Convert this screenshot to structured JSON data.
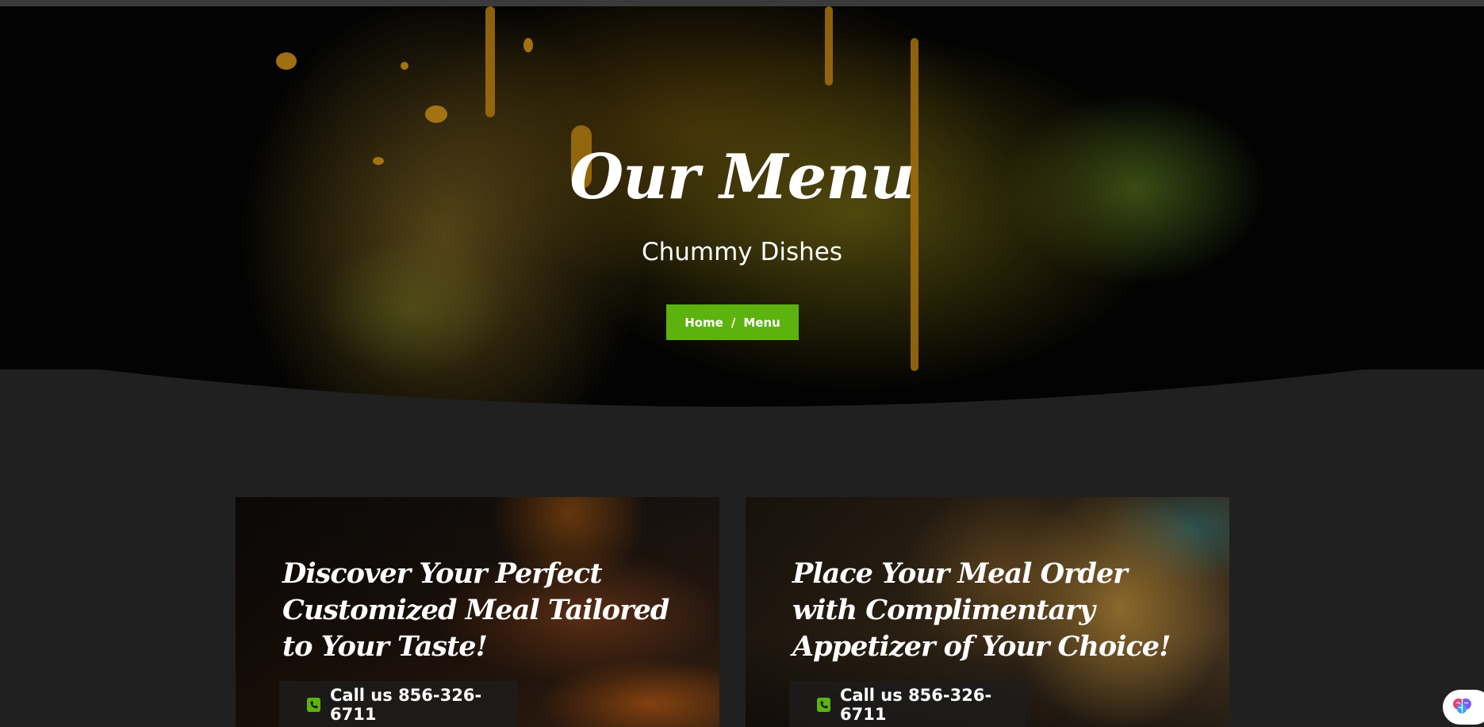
{
  "hero": {
    "title": "Our Menu",
    "subtitle": "Chummy Dishes",
    "breadcrumb": {
      "home": "Home",
      "separator": "/",
      "current": "Menu"
    }
  },
  "cards": [
    {
      "title": "Discover Your Perfect Customized Meal Tailored to Your Taste!",
      "call_label": "Call us 856-326-6711",
      "icon": "phone-icon"
    },
    {
      "title": "Place Your Meal Order with Complimentary Appetizer of Your Choice!",
      "call_label": "Call us 856-326-6711",
      "icon": "phone-icon"
    }
  ],
  "colors": {
    "accent": "#5cb30d",
    "page_bg": "#202020"
  },
  "floating_badge": {
    "icon": "brain-icon"
  }
}
